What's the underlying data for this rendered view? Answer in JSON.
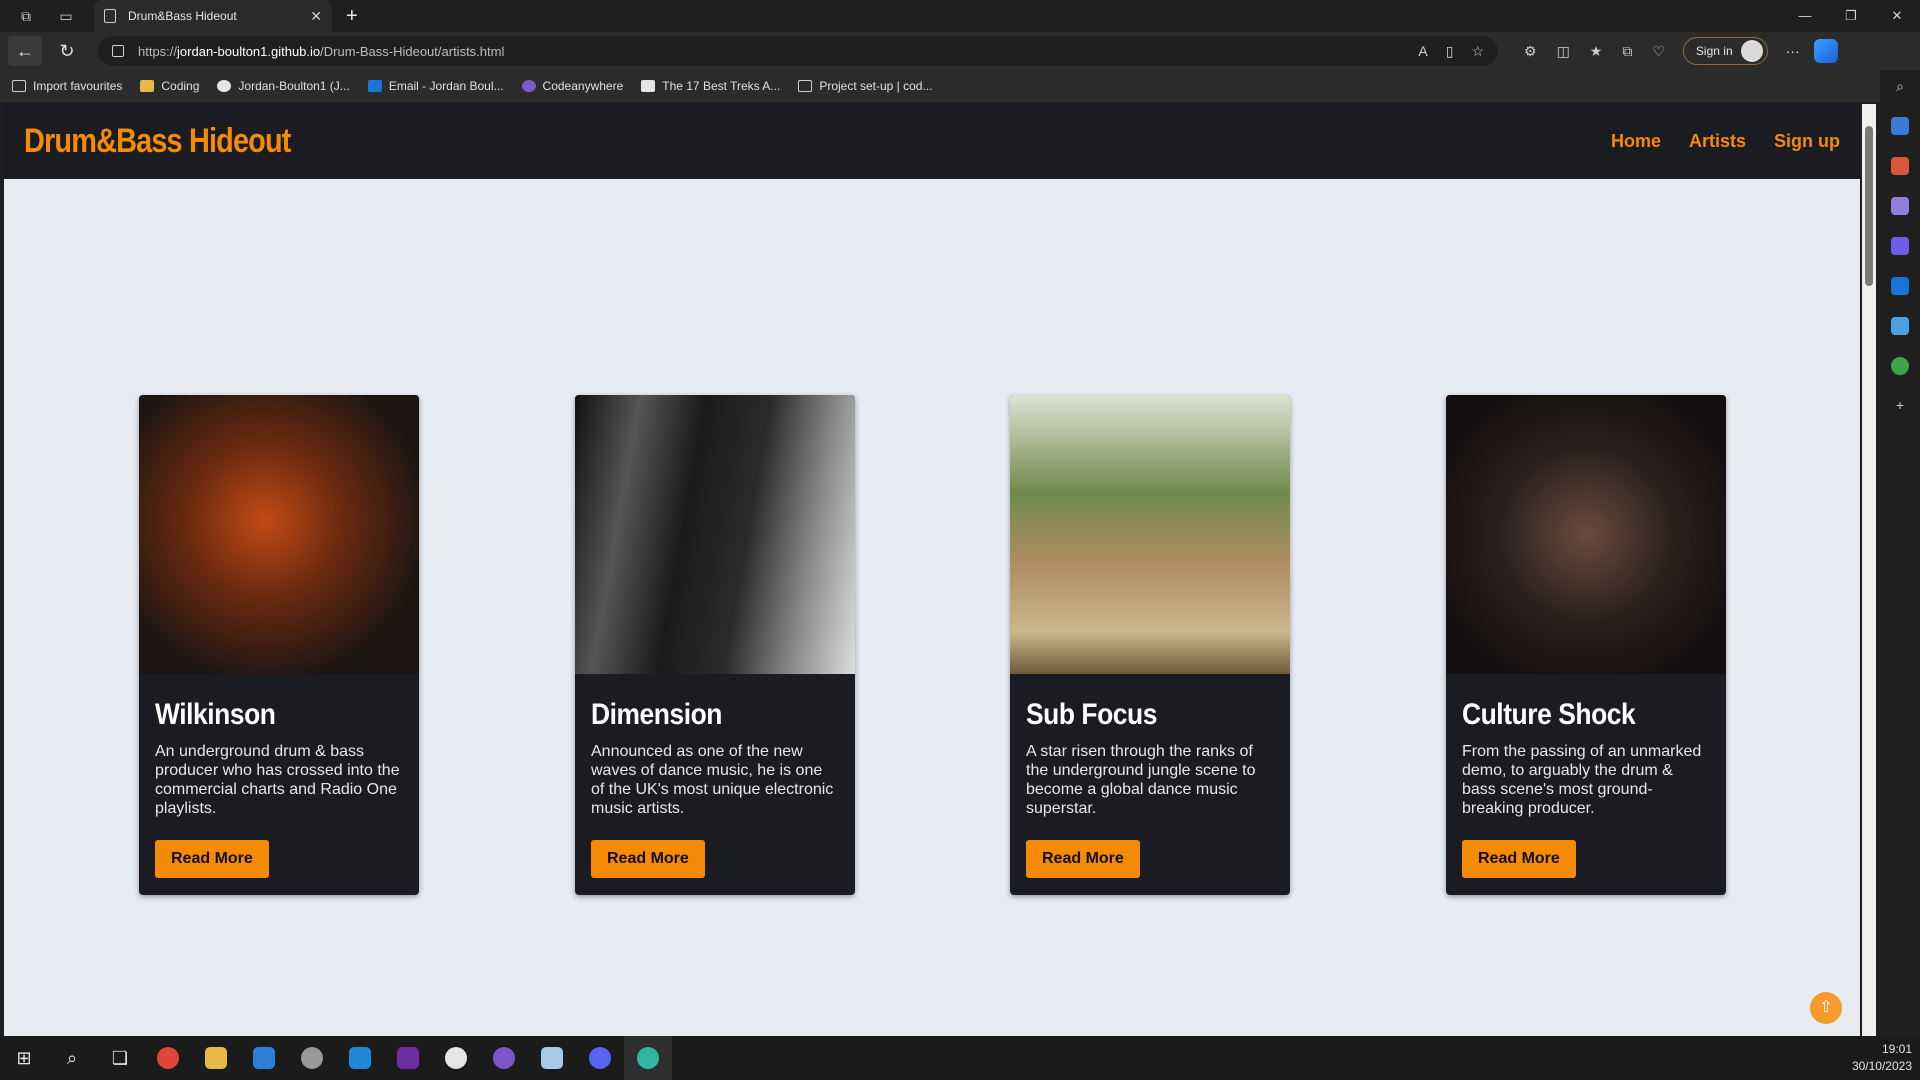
{
  "browser": {
    "tab_title": "Drum&Bass Hideout",
    "url_prefix": "https://",
    "url_domain": "jordan-boulton1.github.io",
    "url_path": "/Drum-Bass-Hideout/artists.html",
    "sign_in_label": "Sign in"
  },
  "bookmarks": [
    {
      "label": "Import favourites",
      "icon": "import-icon"
    },
    {
      "label": "Coding",
      "icon": "folder-icon"
    },
    {
      "label": "Jordan-Boulton1 (J...",
      "icon": "github-icon"
    },
    {
      "label": "Email - Jordan Boul...",
      "icon": "outlook-icon"
    },
    {
      "label": "Codeanywhere",
      "icon": "codeanywhere-icon"
    },
    {
      "label": "The 17 Best Treks A...",
      "icon": "page-icon"
    },
    {
      "label": "Project set-up | cod...",
      "icon": "doc-icon"
    }
  ],
  "site": {
    "logo": "Drum&Bass Hideout",
    "nav": [
      "Home",
      "Artists",
      "Sign up"
    ],
    "accent": "#f58a07",
    "nav_bg": "#1b1b22",
    "page_bg": "#e7ecf3"
  },
  "artists": [
    {
      "name": "Wilkinson",
      "description": "An underground drum & bass producer who has crossed into the commercial charts and Radio One playlists.",
      "button": "Read More"
    },
    {
      "name": "Dimension",
      "description": "Announced as one of the new waves of dance music, he is one of the UK's most unique electronic music artists.",
      "button": "Read More"
    },
    {
      "name": "Sub Focus",
      "description": "A star risen through the ranks of the underground jungle scene to become a global dance music superstar.",
      "button": "Read More"
    },
    {
      "name": "Culture Shock",
      "description": "From the passing of an unmarked demo, to arguably the drum & bass scene's most ground-breaking producer.",
      "button": "Read More"
    }
  ],
  "taskbar": {
    "time": "19:01",
    "date": "30/10/2023"
  }
}
